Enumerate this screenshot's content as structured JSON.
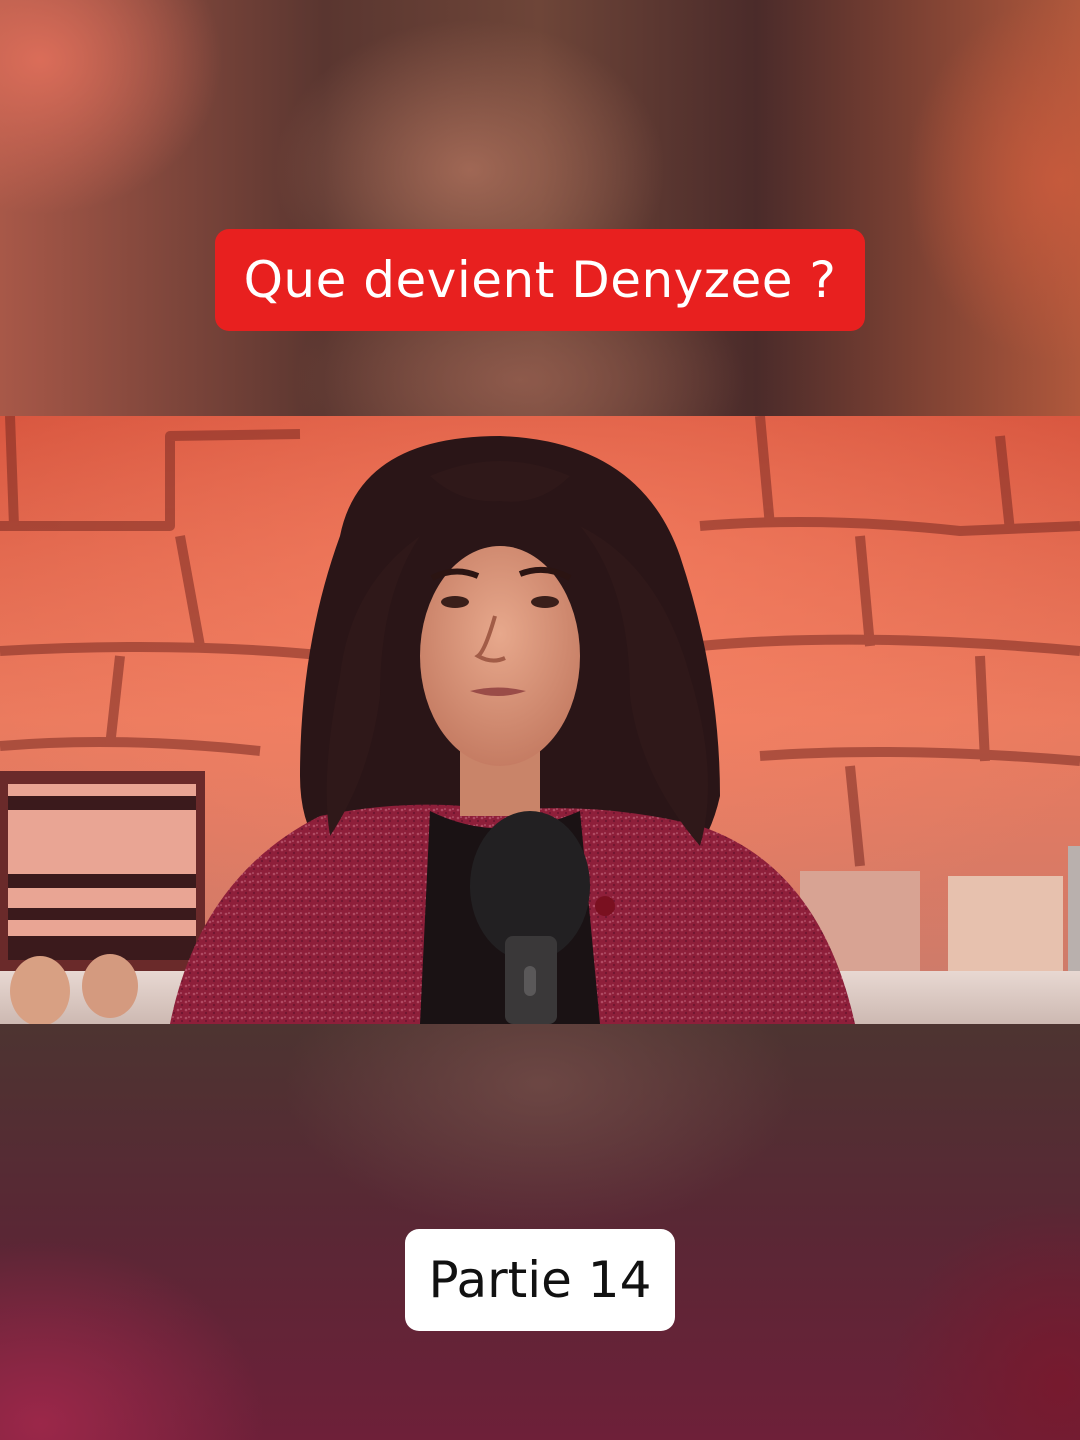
{
  "caption": {
    "title": "Que devient Denyzee ?",
    "part": "Partie 14"
  },
  "colors": {
    "title_badge_bg": "#e8201f",
    "title_text": "#ffffff",
    "part_badge_bg": "#ffffff",
    "part_text": "#111111"
  },
  "video": {
    "scene": "woman-with-curly-hair-speaking-into-microphone-in-front-of-red-lit-stone-wall"
  }
}
